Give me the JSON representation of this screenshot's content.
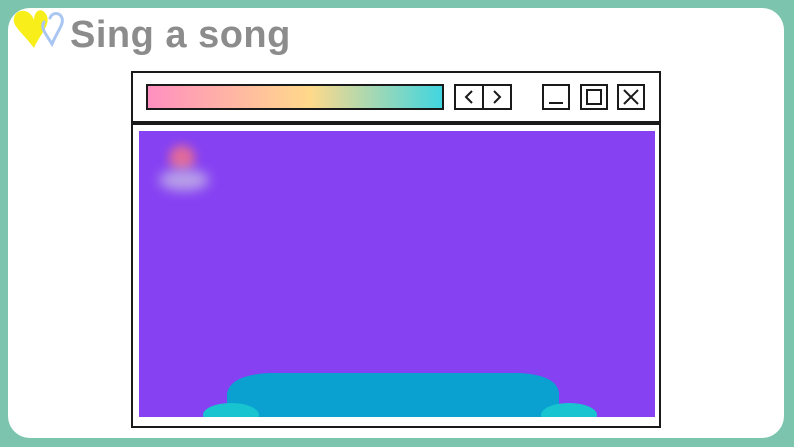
{
  "slide": {
    "title": "Sing a song",
    "colors": {
      "background": "#7cc4ad",
      "panel": "#ffffff",
      "title_text": "#8c8c8c",
      "heart_yellow": "#f7ee1a",
      "heart_blue": "#a9c6f2",
      "video_bg": "#8641f3",
      "sofa": "#0aa0d0"
    }
  },
  "browser_window": {
    "url_bar_gradient": [
      "#ff8fc0",
      "#ffd98a",
      "#41d6e0"
    ],
    "nav_icons": [
      "chevron-left-icon",
      "chevron-right-icon"
    ],
    "window_icons": [
      "minimize-icon",
      "maximize-icon",
      "close-icon"
    ]
  }
}
